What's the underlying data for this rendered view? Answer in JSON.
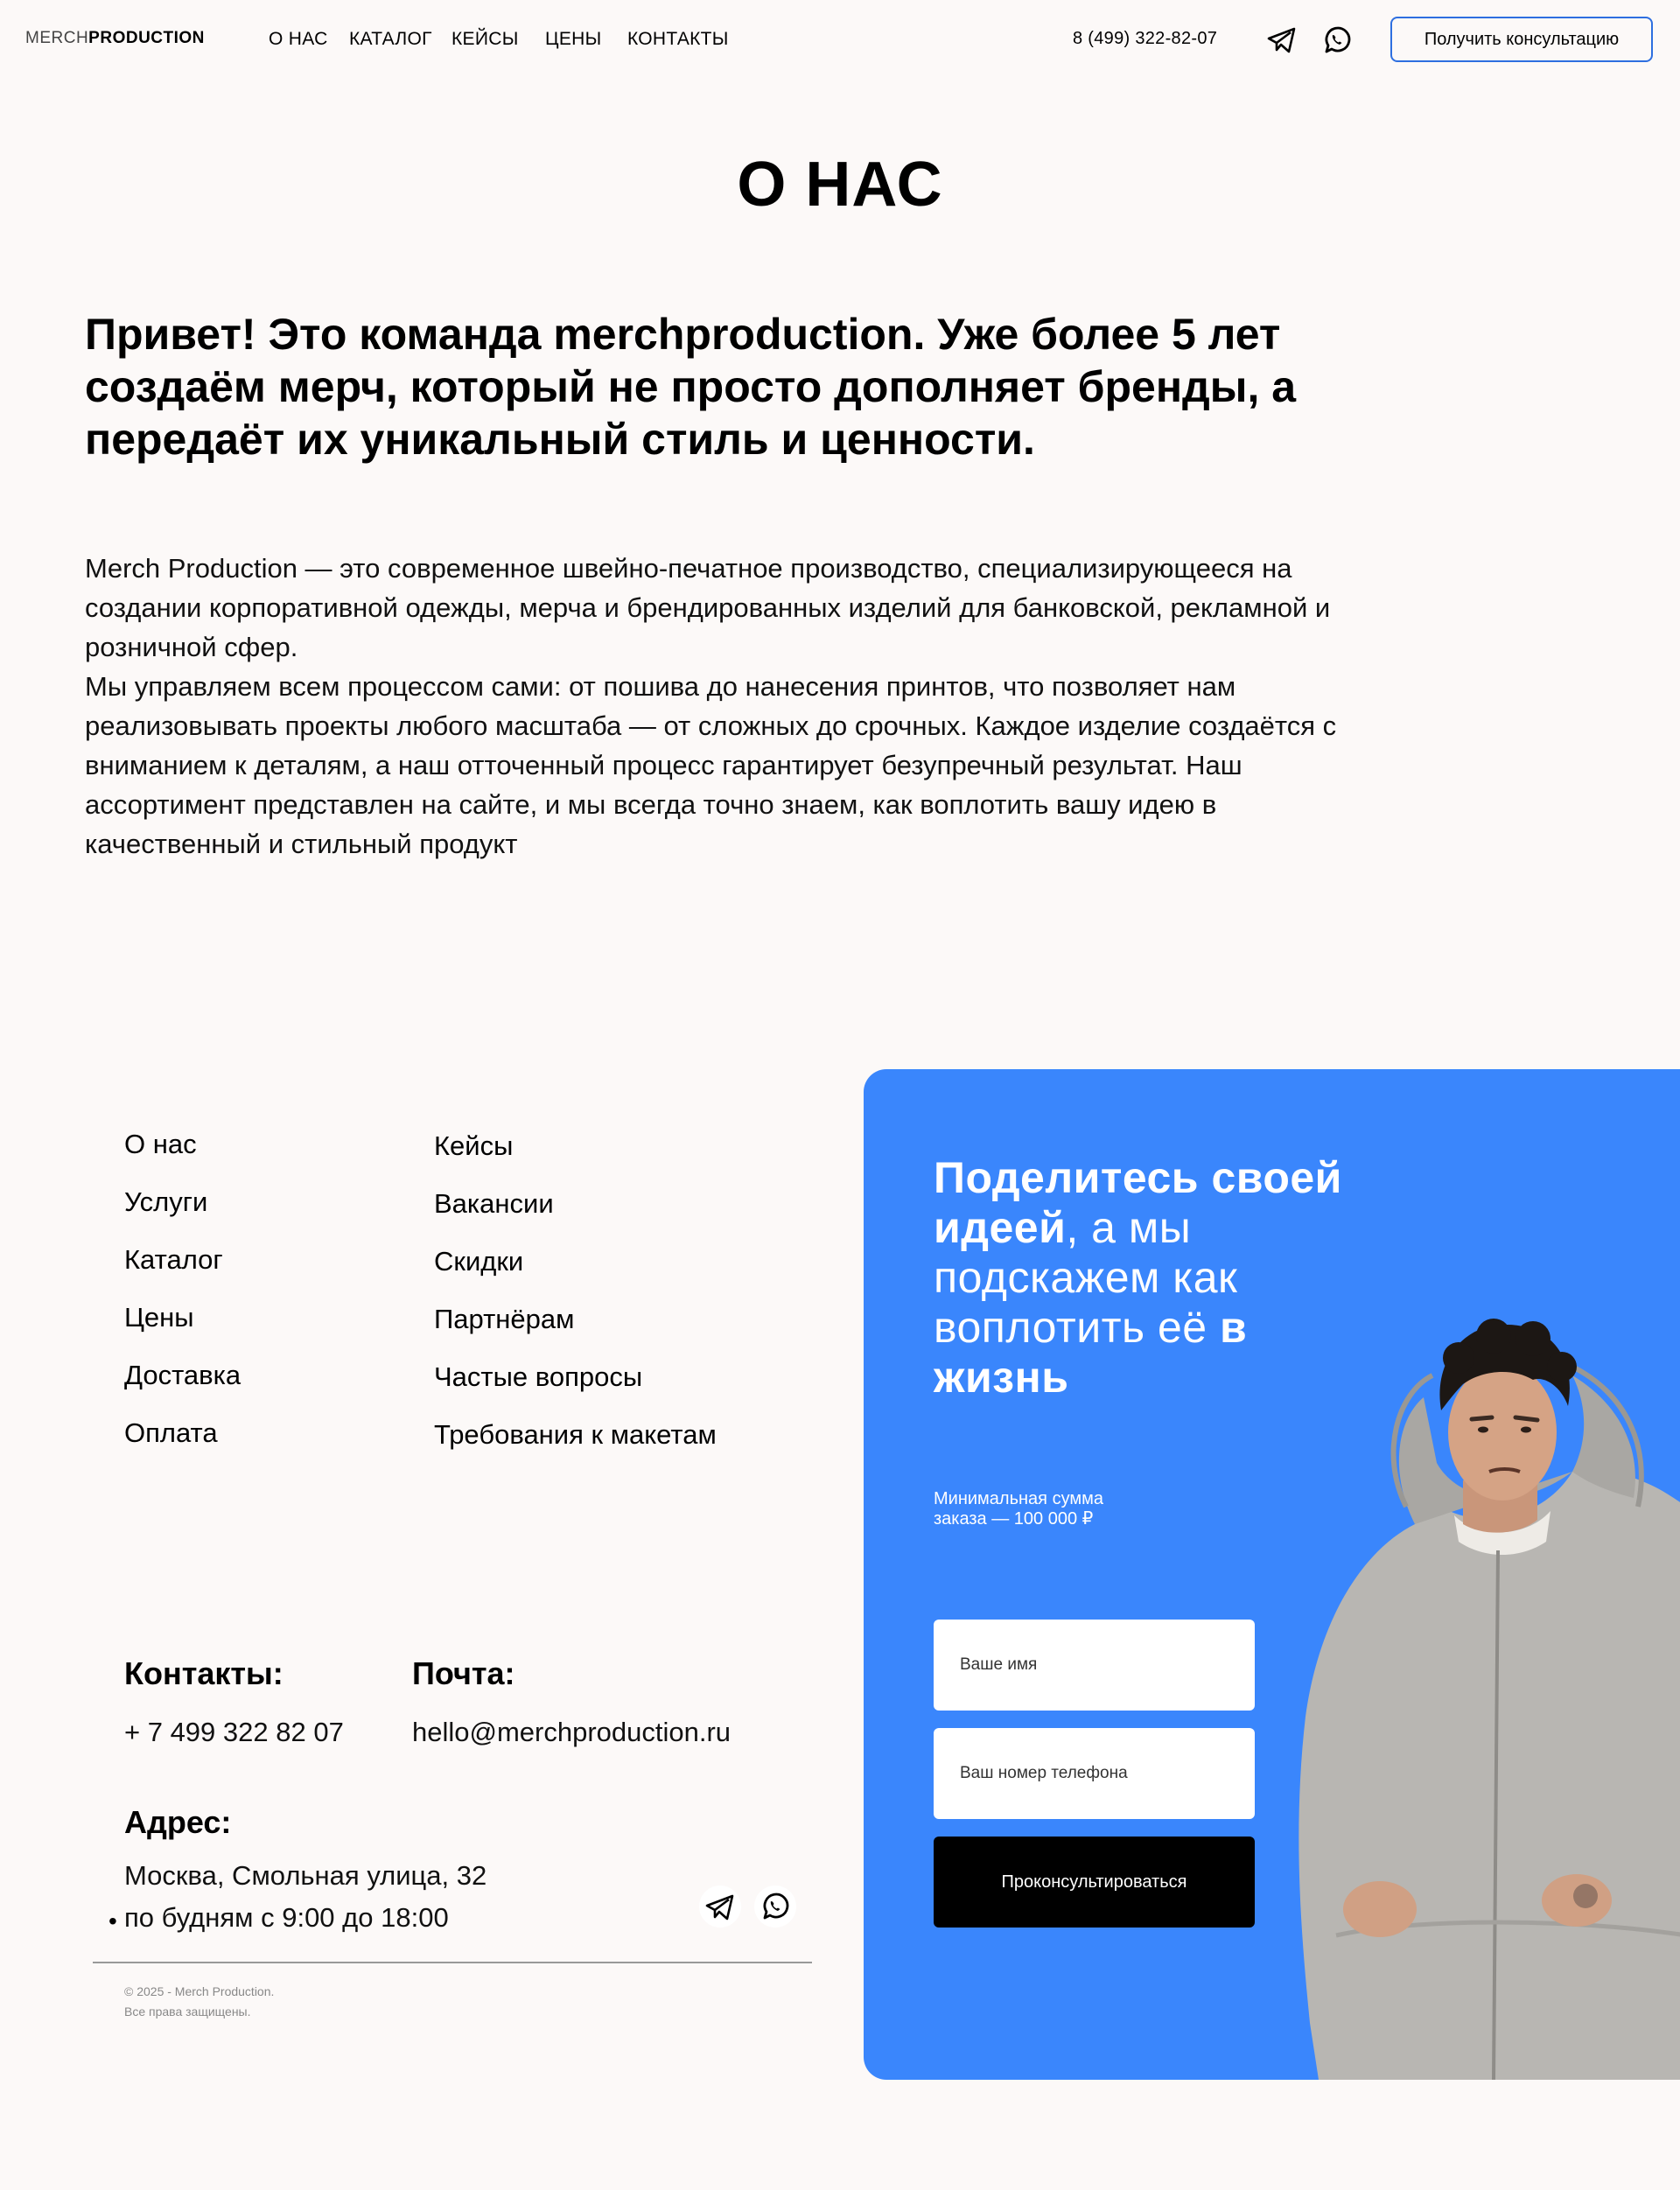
{
  "header": {
    "logo_light": "MERCH",
    "logo_bold": "PRODUCTION",
    "nav": [
      "О НАС",
      "КАТАЛОГ",
      "КЕЙСЫ",
      "ЦЕНЫ",
      "КОНТАКТЫ"
    ],
    "phone": "8 (499) 322-82-07",
    "icons": [
      "telegram-icon",
      "whatsapp-icon"
    ],
    "consult_button": "Получить консультацию"
  },
  "about": {
    "title": "О НАС",
    "lead": "Привет! Это команда merchproduction. Уже более 5 лет создаём мерч, который не просто дополняет бренды, а передаёт их уникальный стиль и ценности.",
    "paragraph1": "Merch Production — это современное швейно-печатное производство, специализирующееся на создании корпоративной одежды, мерча и брендированных изделий для банковской, рекламной и розничной сфер.",
    "paragraph2": "Мы управляем всем процессом сами: от пошива до нанесения принтов, что позволяет нам реализовывать проекты любого масштаба — от сложных до срочных. Каждое изделие создаётся с вниманием к деталям, а наш отточенный процесс гарантирует безупречный результат. Наш ассортимент представлен на сайте, и мы всегда точно знаем, как воплотить вашу идею в качественный и стильный продукт"
  },
  "footer": {
    "links_col1": [
      "О нас",
      "Услуги",
      "Каталог",
      "Цены",
      "Доставка",
      "Оплата"
    ],
    "links_col2": [
      "Кейсы",
      "Вакансии",
      "Скидки",
      "Партнёрам",
      "Частые вопросы",
      "Требования к макетам"
    ],
    "contacts_label": "Контакты:",
    "contacts_value": "+ 7 499 322 82 07",
    "mail_label": "Почта:",
    "mail_value": "hello@merchproduction.ru",
    "address_label": "Адрес:",
    "address_value": "Москва, Смольная улица, 32",
    "hours": "по будням с 9:00 до 18:00",
    "bullet": "•",
    "copyright_line1": "© 2025 - Merch Production.",
    "copyright_line2": "Все права защищены."
  },
  "cta": {
    "title_bold1": "Поделитесь своей идеей",
    "title_comma": ",",
    "title_light": "а мы подскажем как воплотить её",
    "title_bold2": "в жизнь",
    "min_order": "Минимальная сумма заказа — 100 000 ₽",
    "name_placeholder": "Ваше имя",
    "phone_placeholder": "Ваш номер телефона",
    "submit": "Проконсультироваться",
    "bg_color": "#3a86fc"
  }
}
